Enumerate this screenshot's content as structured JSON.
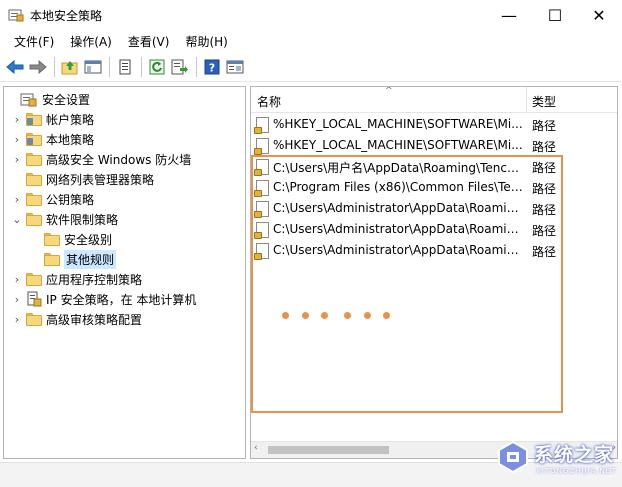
{
  "window": {
    "title": "本地安全策略",
    "min_glyph": "—",
    "max_glyph": "☐",
    "close_glyph": "✕"
  },
  "menu": [
    {
      "label": "文件(F)"
    },
    {
      "label": "操作(A)"
    },
    {
      "label": "查看(V)"
    },
    {
      "label": "帮助(H)"
    }
  ],
  "toolbar": {
    "icons": [
      "back-arrow-icon",
      "forward-arrow-icon",
      "up-folder-icon",
      "show-hide-tree-icon",
      "properties-icon",
      "refresh-icon",
      "export-list-icon",
      "help-icon",
      "mmc-console-icon"
    ]
  },
  "tree": {
    "items": [
      {
        "label": "安全设置",
        "twisty": ""
      },
      {
        "label": "帐户策略",
        "twisty": "›"
      },
      {
        "label": "本地策略",
        "twisty": "›"
      },
      {
        "label": "高级安全 Windows 防火墙",
        "twisty": "›"
      },
      {
        "label": "网络列表管理器策略",
        "twisty": ""
      },
      {
        "label": "公钥策略",
        "twisty": "›"
      },
      {
        "label": "软件限制策略",
        "twisty": "⌄"
      },
      {
        "label": "安全级别",
        "twisty": ""
      },
      {
        "label": "其他规则",
        "twisty": ""
      },
      {
        "label": "应用程序控制策略",
        "twisty": "›"
      },
      {
        "label": "IP 安全策略，在 本地计算机",
        "twisty": "›"
      },
      {
        "label": "高级审核策略配置",
        "twisty": "›"
      }
    ]
  },
  "list": {
    "columns": {
      "name": "名称",
      "type": "类型",
      "sort_glyph": "^"
    },
    "rows": [
      {
        "name": "%HKEY_LOCAL_MACHINE\\SOFTWARE\\Mi...",
        "type": "路径"
      },
      {
        "name": "%HKEY_LOCAL_MACHINE\\SOFTWARE\\Mi...",
        "type": "路径"
      },
      {
        "name": "C:\\Users\\用户名\\AppData\\Roaming\\Tence...",
        "type": "路径"
      },
      {
        "name": "C:\\Program Files (x86)\\Common Files\\Ten...",
        "type": "路径"
      },
      {
        "name": "C:\\Users\\Administrator\\AppData\\Roamin...",
        "type": "路径"
      },
      {
        "name": "C:\\Users\\Administrator\\AppData\\Roamin...",
        "type": "路径"
      },
      {
        "name": "C:\\Users\\Administrator\\AppData\\Roamin...",
        "type": "路径"
      }
    ]
  },
  "scroll": {
    "left_glyph": "‹",
    "right_glyph": "›"
  },
  "annotation": {
    "color": "#e8914b"
  },
  "watermark": {
    "text": "系统之家",
    "sub": "XITONGZHIJIA.NET"
  }
}
